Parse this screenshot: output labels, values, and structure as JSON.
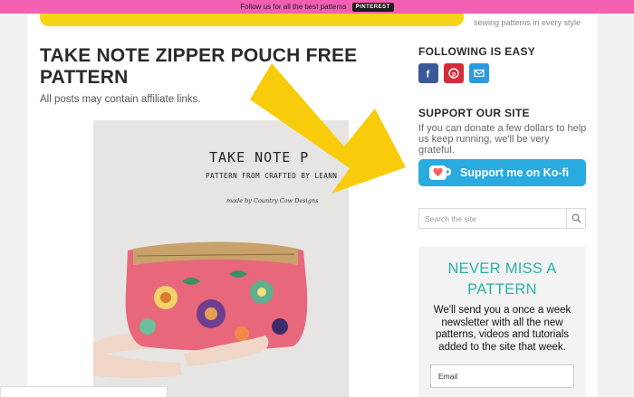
{
  "topbar": {
    "text": "Follow us for all the best patterns",
    "button": "PINTEREST"
  },
  "header": {
    "tagline": "sewing patterns in every style"
  },
  "post": {
    "title": "TAKE NOTE ZIPPER POUCH FREE PATTERN",
    "affiliate": "All posts may contain affiliate links.",
    "image": {
      "title": "TAKE NOTE P",
      "subtitle": "PATTERN FROM CRAFTED BY LEANN",
      "credit": "made by Country Cow Designs"
    }
  },
  "sidebar": {
    "following_heading": "FOLLOWING IS EASY",
    "social": [
      {
        "icon": "facebook-icon",
        "color": "#3b5998"
      },
      {
        "icon": "pinterest-icon",
        "color": "#d32c3a"
      },
      {
        "icon": "email-icon",
        "color": "#2a9ae0"
      }
    ],
    "support_heading": "SUPPORT OUR SITE",
    "support_text": "If you can donate a few dollars to help us keep running, we'll be very grateful.",
    "kofi_label": "Support me on Ko-fi",
    "search_placeholder": "Search the site",
    "signup_title": "NEVER MISS A PATTERN",
    "signup_body": "We'll send you a once a week newsletter with all the new patterns, videos and tutorials added to the site that week.",
    "email_placeholder": "Email"
  },
  "colors": {
    "topbar": "#f35fb1",
    "accent": "#27b3a8",
    "kofi": "#29abe0",
    "arrow": "#f8cc0a"
  }
}
